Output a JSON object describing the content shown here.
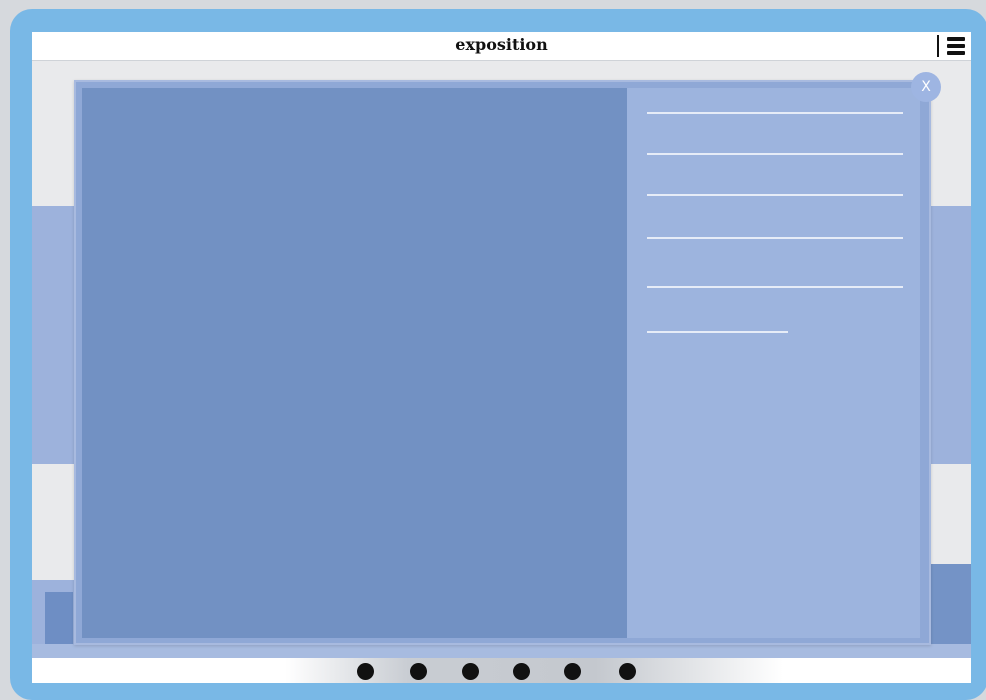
{
  "app": {
    "title": "exposition"
  },
  "header": {
    "menu_icon": "hamburger-menu-icon"
  },
  "modal": {
    "close_label": "X",
    "info_lines": [
      {
        "text": ""
      },
      {
        "text": ""
      },
      {
        "text": ""
      },
      {
        "text": ""
      },
      {
        "text": ""
      },
      {
        "text": ""
      }
    ]
  },
  "pagination": {
    "dots": [
      {
        "label": ""
      },
      {
        "label": ""
      },
      {
        "label": ""
      },
      {
        "label": ""
      },
      {
        "label": ""
      },
      {
        "label": ""
      }
    ]
  },
  "colors": {
    "frame": "#79b8e6",
    "media_panel": "#7291c3",
    "info_panel": "#9db4de",
    "close_button": "#9eb5e2"
  }
}
